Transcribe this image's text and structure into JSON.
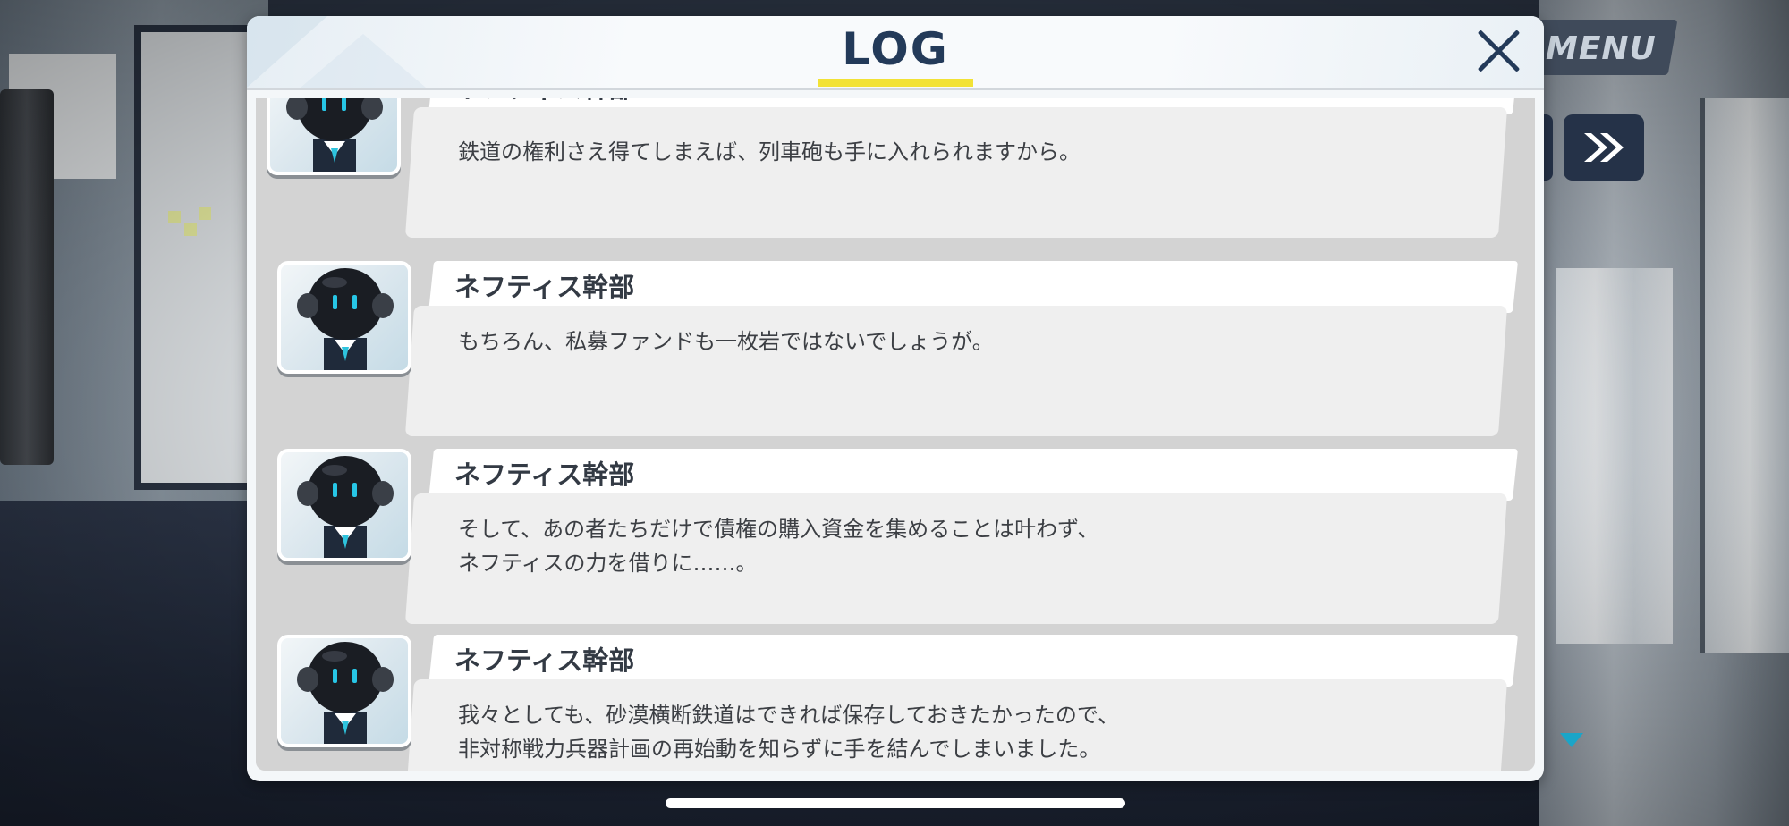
{
  "hud": {
    "menu_label": "MENU",
    "skip_icon": "double-chevron-right-icon"
  },
  "log": {
    "title": "LOG",
    "close_icon": "close-icon",
    "entries": [
      {
        "speaker": "ネフティス幹部",
        "lines": [
          "鉄道の権利さえ得てしまえば、列車砲も手に入れられますから。"
        ]
      },
      {
        "speaker": "ネフティス幹部",
        "lines": [
          "もちろん、私募ファンドも一枚岩ではないでしょうが。"
        ]
      },
      {
        "speaker": "ネフティス幹部",
        "lines": [
          "そして、あの者たちだけで債権の購入資金を集めることは叶わず、",
          "ネフティスの力を借りに……。"
        ]
      },
      {
        "speaker": "ネフティス幹部",
        "lines": [
          "我々としても、砂漠横断鉄道はできれば保存しておきたかったので、",
          "非対称戦力兵器計画の再始動を知らずに手を結んでしまいました。"
        ]
      }
    ]
  },
  "colors": {
    "title": "#233a59",
    "underline": "#f2e236",
    "eye_glow": "#27c6e6",
    "hud_button": "#253248"
  }
}
